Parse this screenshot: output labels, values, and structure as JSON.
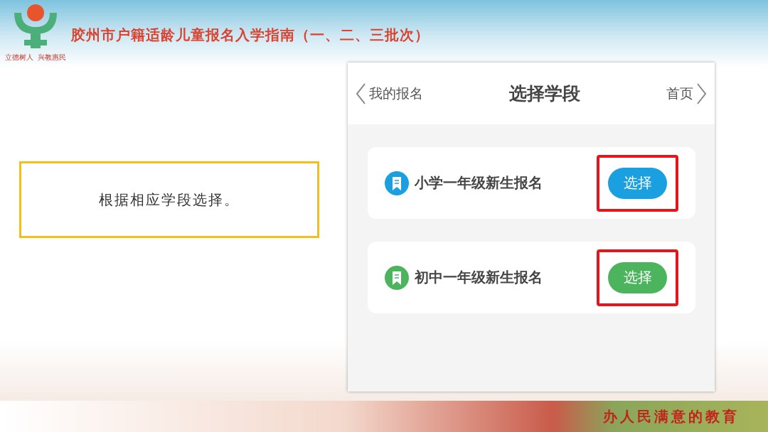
{
  "logo": {
    "motto": "立德树人  兴教惠民"
  },
  "title": "胶州市户籍适龄儿童报名入学指南（一、二、三批次）",
  "note": "根据相应学段选择。",
  "phone": {
    "back": "我的报名",
    "heading": "选择学段",
    "home": "首页",
    "options": [
      {
        "label": "小学一年级新生报名",
        "button": "选择",
        "color": "#1a9fe0",
        "highlighted": true
      },
      {
        "label": "初中一年级新生报名",
        "button": "选择",
        "color": "#4cb45c",
        "highlighted": true
      }
    ]
  },
  "slogan": "办人民满意的教育"
}
